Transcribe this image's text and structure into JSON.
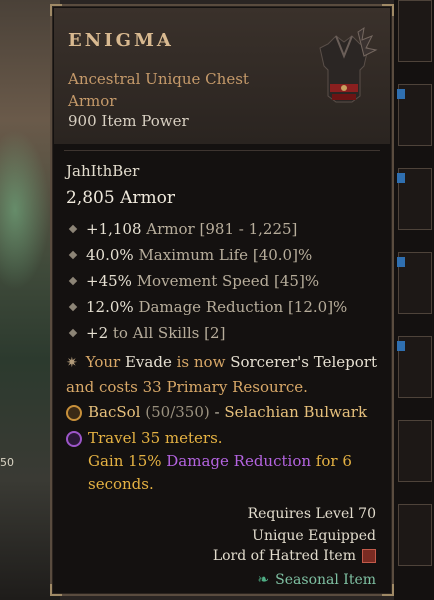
{
  "world": {
    "side_number": "50"
  },
  "item": {
    "name": "ENIGMA",
    "rarity_line": "Ancestral Unique Chest",
    "type_line": "Armor",
    "power": "900 Item Power",
    "runeword_name": "JahIthBer",
    "armor_value": "2,805 Armor",
    "affixes": [
      {
        "value": "+1,108",
        "name": "Armor",
        "range": "[981 - 1,225]"
      },
      {
        "value": "40.0%",
        "name": "Maximum Life",
        "range": "[40.0]%"
      },
      {
        "value": "+45%",
        "name": "Movement Speed",
        "range": "[45]%"
      },
      {
        "value": "12.0%",
        "name": "Damage Reduction",
        "range": "[12.0]%"
      },
      {
        "value": "+2",
        "name": "to All Skills",
        "range": "[2]"
      }
    ],
    "unique_power": {
      "p1": "Your",
      "p2": "Evade",
      "p3": "is now",
      "p4": "Sorcerer's",
      "p5": "Teleport",
      "p6": "and costs 33 Primary Resource."
    },
    "runeword": {
      "name": "BacSol",
      "progress": "(50/350)",
      "dash": "-",
      "effect_name": "Selachian Bulwark",
      "condition": "Travel 35 meters.",
      "effect_a": "Gain 15%",
      "effect_b": "Damage Reduction",
      "effect_c": "for",
      "effect_d": "6",
      "effect_e": "seconds."
    },
    "requirements": "Requires Level 70",
    "unique_equipped": "Unique Equipped",
    "lord_item": "Lord of Hatred Item",
    "seasonal": "Seasonal Item"
  },
  "colors": {
    "unique": "#d8a868",
    "runeword_gold": "#e5b243",
    "runeword_purple": "#b464e0",
    "seasonal": "#7fc0a2"
  }
}
